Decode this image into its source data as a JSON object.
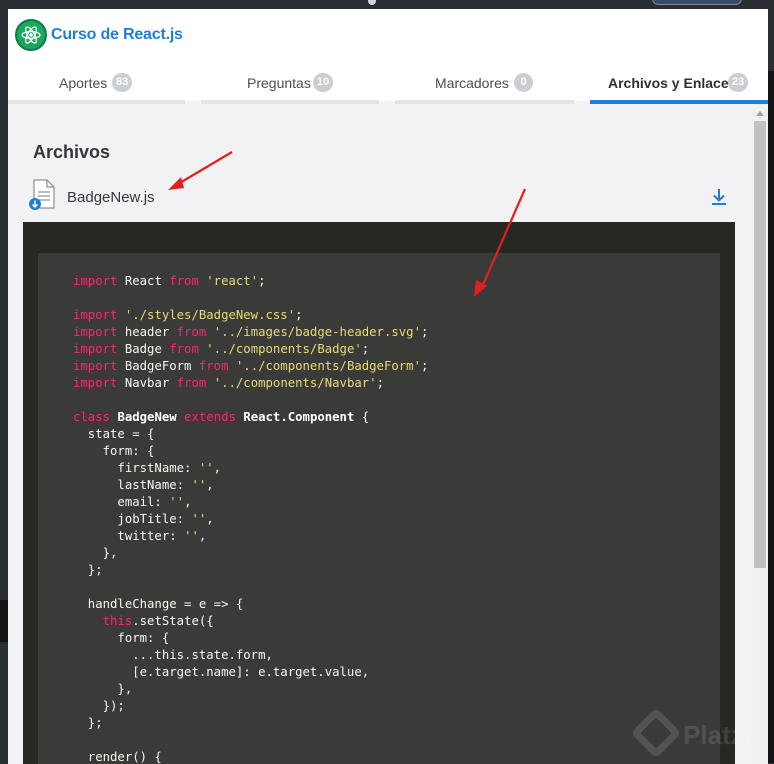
{
  "course": {
    "title": "Curso de React.js",
    "logo_icon": "react-atom-icon"
  },
  "tabs": [
    {
      "label": "Aportes",
      "count": "83",
      "active": false
    },
    {
      "label": "Preguntas",
      "count": "10",
      "active": false
    },
    {
      "label": "Marcadores",
      "count": "0",
      "active": false
    },
    {
      "label": "Archivos y Enlaces",
      "count": "23",
      "active": true
    }
  ],
  "files_section": {
    "title": "Archivos",
    "file": {
      "name": "BadgeNew.js",
      "file_icon": "js-file-icon",
      "action_icon": "download-icon"
    }
  },
  "code": {
    "lines": [
      [
        [
          "kw",
          "import"
        ],
        [
          "plain",
          " React "
        ],
        [
          "kw",
          "from"
        ],
        [
          "plain",
          " "
        ],
        [
          "str",
          "'react'"
        ],
        [
          "plain",
          ";"
        ]
      ],
      [],
      [
        [
          "kw",
          "import"
        ],
        [
          "plain",
          " "
        ],
        [
          "str",
          "'./styles/BadgeNew.css'"
        ],
        [
          "plain",
          ";"
        ]
      ],
      [
        [
          "kw",
          "import"
        ],
        [
          "plain",
          " header "
        ],
        [
          "kw",
          "from"
        ],
        [
          "plain",
          " "
        ],
        [
          "str",
          "'../images/badge-header.svg'"
        ],
        [
          "plain",
          ";"
        ]
      ],
      [
        [
          "kw",
          "import"
        ],
        [
          "plain",
          " Badge "
        ],
        [
          "kw",
          "from"
        ],
        [
          "plain",
          " "
        ],
        [
          "str",
          "'../components/Badge'"
        ],
        [
          "plain",
          ";"
        ]
      ],
      [
        [
          "kw",
          "import"
        ],
        [
          "plain",
          " BadgeForm "
        ],
        [
          "kw",
          "from"
        ],
        [
          "plain",
          " "
        ],
        [
          "str",
          "'../components/BadgeForm'"
        ],
        [
          "plain",
          ";"
        ]
      ],
      [
        [
          "kw",
          "import"
        ],
        [
          "plain",
          " Navbar "
        ],
        [
          "kw",
          "from"
        ],
        [
          "plain",
          " "
        ],
        [
          "str",
          "'../components/Navbar'"
        ],
        [
          "plain",
          ";"
        ]
      ],
      [],
      [
        [
          "kw",
          "class"
        ],
        [
          "plain",
          " "
        ],
        [
          "cls",
          "BadgeNew"
        ],
        [
          "plain",
          " "
        ],
        [
          "kw",
          "extends"
        ],
        [
          "plain",
          " "
        ],
        [
          "cls",
          "React.Component"
        ],
        [
          "plain",
          " {"
        ]
      ],
      [
        [
          "plain",
          "  state = {"
        ]
      ],
      [
        [
          "plain",
          "    form: {"
        ]
      ],
      [
        [
          "plain",
          "      firstName: "
        ],
        [
          "str",
          "''"
        ],
        [
          "plain",
          ","
        ]
      ],
      [
        [
          "plain",
          "      lastName: "
        ],
        [
          "str",
          "''"
        ],
        [
          "plain",
          ","
        ]
      ],
      [
        [
          "plain",
          "      email: "
        ],
        [
          "str",
          "''"
        ],
        [
          "plain",
          ","
        ]
      ],
      [
        [
          "plain",
          "      jobTitle: "
        ],
        [
          "str",
          "''"
        ],
        [
          "plain",
          ","
        ]
      ],
      [
        [
          "plain",
          "      twitter: "
        ],
        [
          "str",
          "''"
        ],
        [
          "plain",
          ","
        ]
      ],
      [
        [
          "plain",
          "    },"
        ]
      ],
      [
        [
          "plain",
          "  };"
        ]
      ],
      [],
      [
        [
          "plain",
          "  handleChange = e => {"
        ]
      ],
      [
        [
          "plain",
          "    "
        ],
        [
          "kw",
          "this"
        ],
        [
          "plain",
          ".setState({"
        ]
      ],
      [
        [
          "plain",
          "      form: {"
        ]
      ],
      [
        [
          "plain",
          "        ...this.state.form,"
        ]
      ],
      [
        [
          "plain",
          "        [e.target.name]: e.target.value,"
        ]
      ],
      [
        [
          "plain",
          "      },"
        ]
      ],
      [
        [
          "plain",
          "    });"
        ]
      ],
      [
        [
          "plain",
          "  };"
        ]
      ],
      [],
      [
        [
          "plain",
          "  render() {"
        ]
      ]
    ]
  },
  "watermark": {
    "text": "Platzi"
  },
  "colors": {
    "accent": "#1f7fd6",
    "brand_green": "#1aa861",
    "annotation_arrow": "#e02020",
    "code_keyword": "#f92672",
    "code_string": "#e6db74"
  }
}
